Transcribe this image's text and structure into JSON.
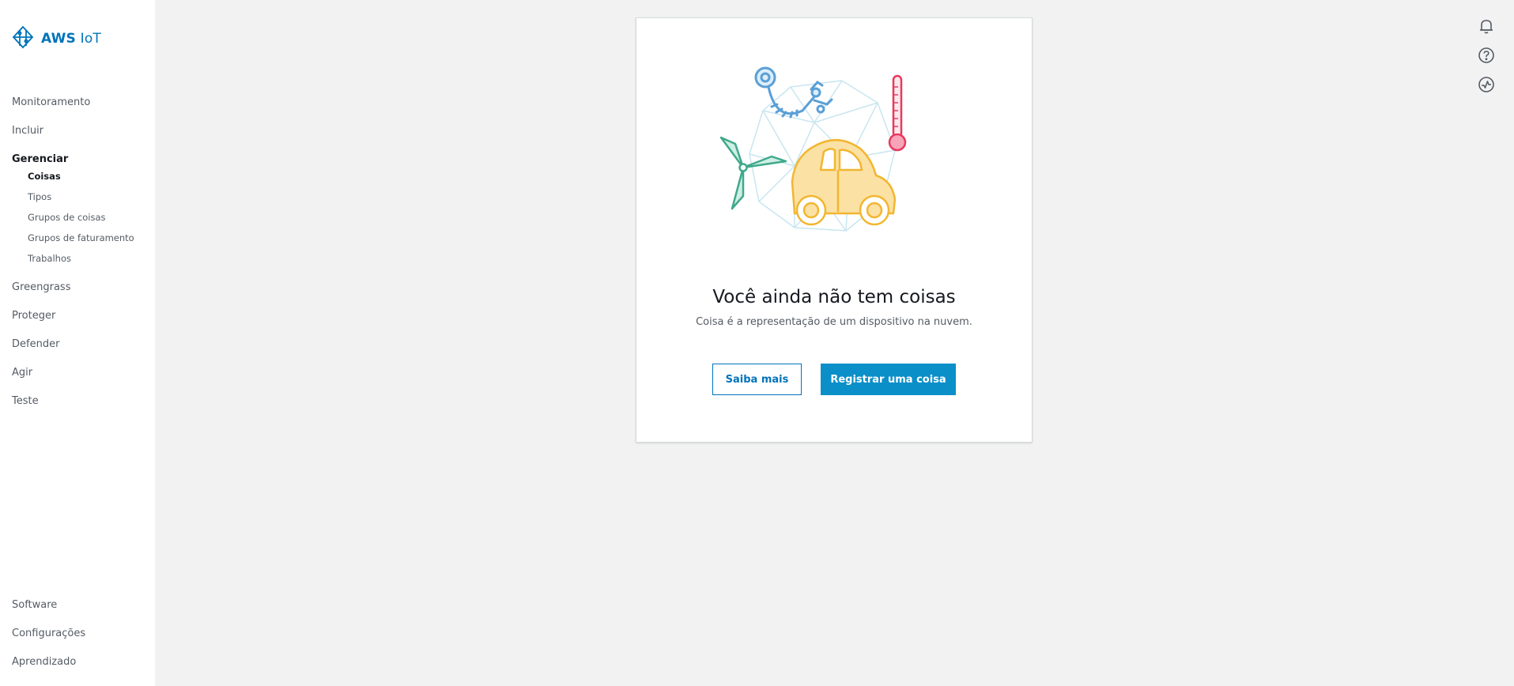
{
  "brand": {
    "name_prefix": "AWS",
    "name_suffix": "IoT"
  },
  "sidebar": {
    "top_items": [
      {
        "label": "Monitoramento"
      },
      {
        "label": "Incluir"
      },
      {
        "label": "Gerenciar",
        "active": true
      }
    ],
    "manage_subitems": [
      {
        "label": "Coisas",
        "active": true
      },
      {
        "label": "Tipos"
      },
      {
        "label": "Grupos de coisas"
      },
      {
        "label": "Grupos de faturamento"
      },
      {
        "label": "Trabalhos"
      }
    ],
    "mid_items": [
      {
        "label": "Greengrass"
      },
      {
        "label": "Proteger"
      },
      {
        "label": "Defender"
      },
      {
        "label": "Agir"
      },
      {
        "label": "Teste"
      }
    ],
    "bottom_items": [
      {
        "label": "Software"
      },
      {
        "label": "Configurações"
      },
      {
        "label": "Aprendizado"
      }
    ]
  },
  "empty_state": {
    "title": "Você ainda não tem coisas",
    "description": "Coisa é a representação de um dispositivo na nuvem.",
    "secondary_button": "Saiba mais",
    "primary_button": "Registrar uma coisa"
  },
  "utility_icons": [
    "bell-icon",
    "help-icon",
    "activity-icon"
  ],
  "colors": {
    "accent": "#0073bb",
    "primary_button": "#0a8fc9",
    "car": "#f2b630",
    "thermometer": "#e8395e",
    "turbine": "#3fa98b",
    "robot_arm": "#5a9fd6",
    "globe": "#c8e6f0"
  }
}
